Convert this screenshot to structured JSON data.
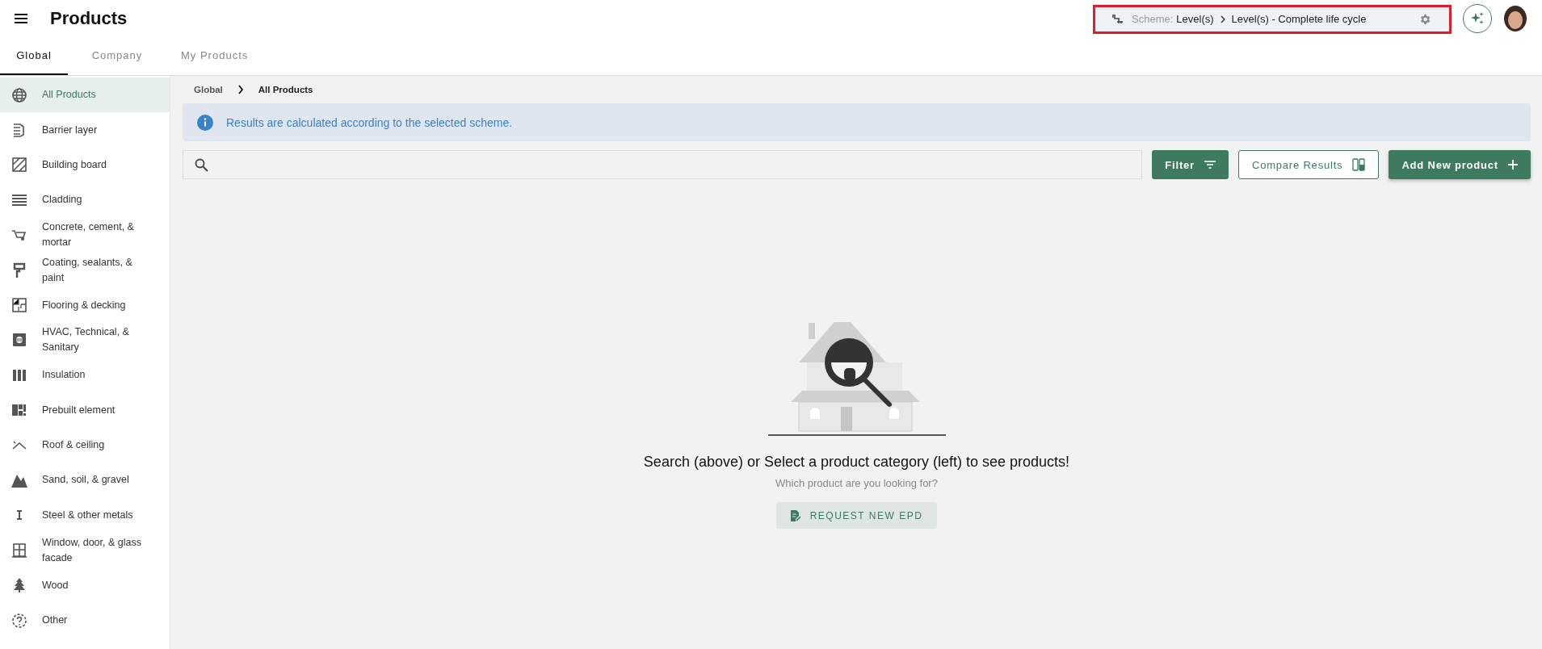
{
  "header": {
    "title": "Products",
    "scheme": {
      "label": "Scheme:",
      "level": "Level(s)",
      "value": "Level(s) - Complete life cycle",
      "highlighted": true
    }
  },
  "tabs": [
    {
      "label": "Global",
      "selected": true
    },
    {
      "label": "Company",
      "selected": false
    },
    {
      "label": "My Products",
      "selected": false
    }
  ],
  "sidebar": {
    "items": [
      {
        "label": "All Products",
        "selected": true
      },
      {
        "label": "Barrier layer",
        "selected": false
      },
      {
        "label": "Building board",
        "selected": false
      },
      {
        "label": "Cladding",
        "selected": false
      },
      {
        "label": "Concrete, cement, & mortar",
        "selected": false
      },
      {
        "label": "Coating, sealants, & paint",
        "selected": false
      },
      {
        "label": "Flooring & decking",
        "selected": false
      },
      {
        "label": "HVAC, Technical, & Sanitary",
        "selected": false
      },
      {
        "label": "Insulation",
        "selected": false
      },
      {
        "label": "Prebuilt element",
        "selected": false
      },
      {
        "label": "Roof & ceiling",
        "selected": false
      },
      {
        "label": "Sand, soil, & gravel",
        "selected": false
      },
      {
        "label": "Steel & other metals",
        "selected": false
      },
      {
        "label": "Window, door, & glass facade",
        "selected": false
      },
      {
        "label": "Wood",
        "selected": false
      },
      {
        "label": "Other",
        "selected": false
      }
    ]
  },
  "breadcrumb": [
    "Global",
    "All Products"
  ],
  "info_banner": "Results are calculated according to the selected scheme.",
  "buttons": {
    "filter": "Filter",
    "compare": "Compare Results",
    "add": "Add New product"
  },
  "empty_state": {
    "heading": "Search (above) or Select a product category (left) to see products!",
    "subtext": "Which product are you looking for?",
    "button": "REQUEST NEW EPD"
  }
}
